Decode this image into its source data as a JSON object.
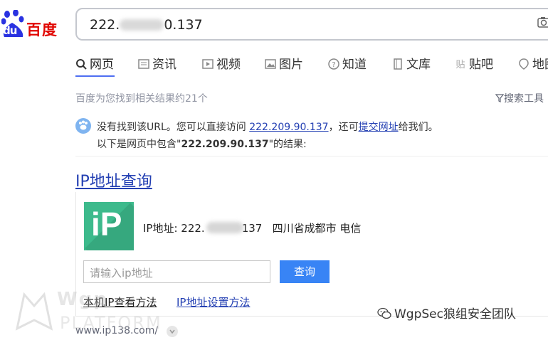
{
  "logo": {
    "du": "du",
    "brand": "百度"
  },
  "search": {
    "query_prefix": "222.",
    "query_suffix": "0.137"
  },
  "tabs": [
    {
      "label": "网页",
      "icon": "search-icon"
    },
    {
      "label": "资讯",
      "icon": "news-icon"
    },
    {
      "label": "视频",
      "icon": "video-icon"
    },
    {
      "label": "图片",
      "icon": "image-icon"
    },
    {
      "label": "知道",
      "icon": "question-icon"
    },
    {
      "label": "文库",
      "icon": "document-icon"
    },
    {
      "label": "贴吧",
      "icon": "tieba-icon"
    },
    {
      "label": "地图",
      "icon": "map-icon"
    }
  ],
  "results": {
    "count_text": "百度为您找到相关结果约21个",
    "tools_label": "搜索工具"
  },
  "notice": {
    "line1_prefix": "没有找到该URL。您可以直接访问 ",
    "line1_link": "222.209.90.137",
    "line1_mid": "，还可",
    "line1_link2": "提交网址",
    "line1_suffix": "给我们。",
    "line2_prefix": "以下是网页中包含\"",
    "line2_bold": "222.209.90.137",
    "line2_suffix": "\"的结果:"
  },
  "result": {
    "title": "IP地址查询",
    "logo_text": "iP",
    "ip_label": "IP地址: 222.",
    "ip_suffix": "137",
    "location": "四川省成都市 电信",
    "input_placeholder": "请输入ip地址",
    "query_button": "查询",
    "link1": "本机IP查看方法",
    "link2": "IP地址设置方法",
    "url": "www.ip138.com/"
  },
  "watermark": {
    "left_line1": "Wgp",
    "left_line2": "PLATFORM",
    "right": "WgpSec狼组安全团队"
  },
  "colors": {
    "brand_red": "#e10601",
    "brand_blue": "#2932e1",
    "link": "#2440b3",
    "accent": "#4e6ef2",
    "ip_green": "#3dba8c",
    "button": "#3884f5"
  }
}
